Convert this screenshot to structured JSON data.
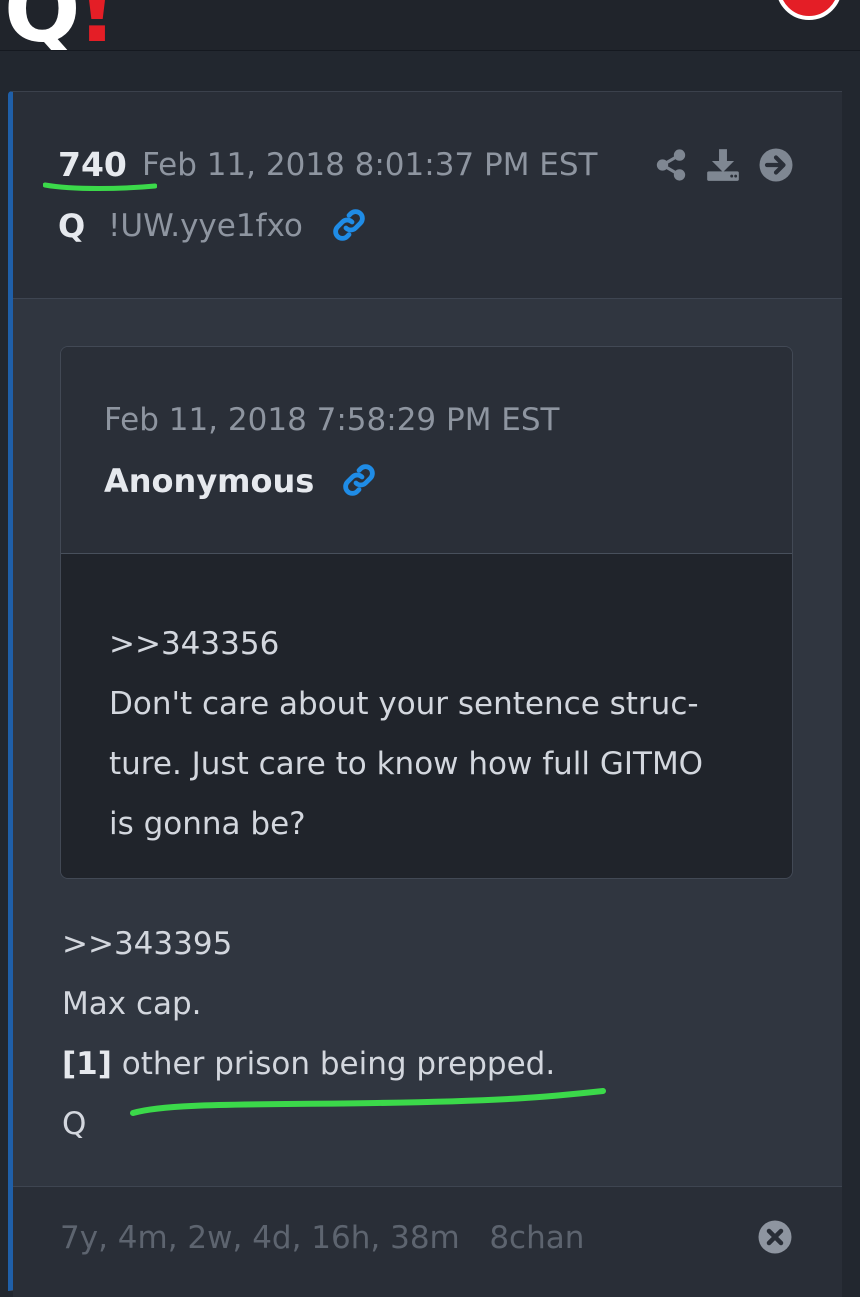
{
  "app": {
    "logo_text": "Q",
    "logo_mark": "!",
    "menu_icon": "menu-icon"
  },
  "post": {
    "number": "740",
    "timestamp": "Feb 11, 2018 8:01:37 PM EST",
    "author": "Q",
    "tripcode": "!UW.yye1fxo",
    "icons": [
      "link-icon",
      "share-icon",
      "download-icon",
      "arrow-right-circle-icon"
    ],
    "quoted": {
      "timestamp": "Feb 11, 2018 7:58:29 PM EST",
      "author": "Anonymous",
      "lines": [
        ">>343356",
        "Don't care about your sentence struc-",
        "ture. Just care to know how full GITMO",
        "is gonna be?"
      ]
    },
    "reply": {
      "line1": ">>343395",
      "line2": "Max cap.",
      "line3_bold": "[1]",
      "line3_rest": "other prison being prepped.",
      "line4": "Q"
    },
    "footer": {
      "age": "7y, 4m, 2w, 4d, 16h, 38m",
      "source": "8chan"
    }
  },
  "colors": {
    "background": "#22272f",
    "card": "#2a2f38",
    "accent_blue": "#1f5fa8",
    "link_blue": "#1f8ce6",
    "highlight_green": "#3bd94a",
    "logo_red": "#e41e26"
  }
}
